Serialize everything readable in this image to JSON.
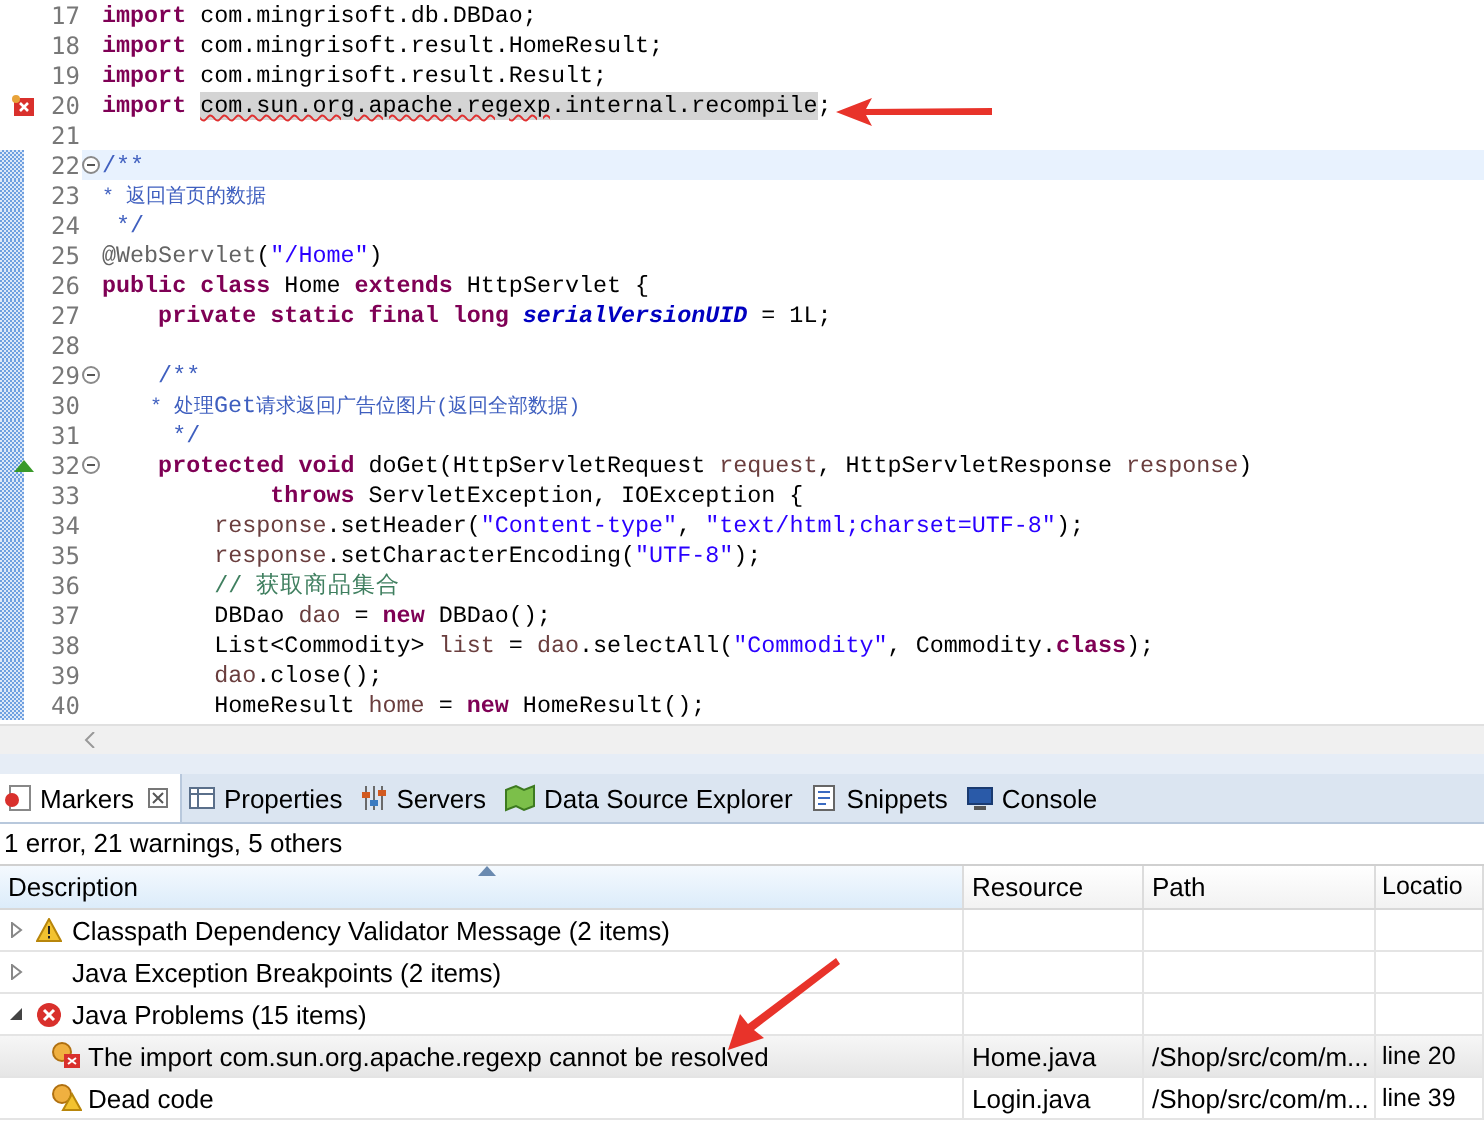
{
  "editor": {
    "lines": [
      {
        "number": "17",
        "kind": "plain",
        "fold": false,
        "range": false,
        "current": false,
        "tokens": [
          {
            "kind": "kw",
            "text": "import "
          },
          {
            "kind": "plain",
            "text": "com.mingrisoft.db.DBDao;"
          }
        ]
      },
      {
        "number": "18",
        "kind": "plain",
        "fold": false,
        "range": false,
        "current": false,
        "tokens": [
          {
            "kind": "kw",
            "text": "import "
          },
          {
            "kind": "plain",
            "text": "com.mingrisoft.result.HomeResult;"
          }
        ]
      },
      {
        "number": "19",
        "kind": "plain",
        "fold": false,
        "range": false,
        "current": false,
        "tokens": [
          {
            "kind": "kw",
            "text": "import "
          },
          {
            "kind": "plain",
            "text": "com.mingrisoft.result.Result;"
          }
        ]
      },
      {
        "number": "20",
        "kind": "error",
        "fold": false,
        "range": false,
        "current": false,
        "tokens": [
          {
            "kind": "kw",
            "text": "import "
          },
          {
            "kind": "error",
            "text": "com.sun.org.apache.regexp"
          },
          {
            "kind": "selected",
            "text": ".internal.recompile"
          },
          {
            "kind": "plain",
            "text": ";"
          }
        ]
      },
      {
        "number": "21",
        "kind": "plain",
        "fold": false,
        "range": false,
        "current": false
      },
      {
        "number": "22",
        "kind": "plain",
        "fold": true,
        "range": true,
        "current": true,
        "tokens": [
          {
            "kind": "javadoc",
            "text": "/**"
          }
        ]
      },
      {
        "number": "23",
        "kind": "plain",
        "fold": false,
        "range": true,
        "current": false,
        "tokens": [
          {
            "kind": "javadoc-cjk",
            "text": "* 返回首页的数据"
          }
        ]
      },
      {
        "number": "24",
        "kind": "plain",
        "fold": false,
        "range": true,
        "current": false,
        "tokens": [
          {
            "kind": "javadoc",
            "text": " */"
          }
        ]
      },
      {
        "number": "25",
        "kind": "plain",
        "fold": false,
        "range": true,
        "current": false,
        "tokens": [
          {
            "kind": "annot",
            "text": "@WebServlet"
          },
          {
            "kind": "plain",
            "text": "("
          },
          {
            "kind": "str",
            "text": "\"/Home\""
          },
          {
            "kind": "plain",
            "text": ")"
          }
        ]
      },
      {
        "number": "26",
        "kind": "plain",
        "fold": false,
        "range": true,
        "current": false,
        "tokens": [
          {
            "kind": "kw",
            "text": "public class"
          },
          {
            "kind": "plain",
            "text": " Home "
          },
          {
            "kind": "kw",
            "text": "extends"
          },
          {
            "kind": "plain",
            "text": " HttpServlet {"
          }
        ]
      },
      {
        "number": "27",
        "kind": "plain",
        "fold": false,
        "range": true,
        "current": false,
        "tokens": [
          {
            "kind": "kw",
            "text": "    private static final long "
          },
          {
            "kind": "field",
            "text": "serialVersionUID"
          },
          {
            "kind": "plain",
            "text": " = 1L;"
          }
        ]
      },
      {
        "number": "28",
        "kind": "plain",
        "fold": false,
        "range": true,
        "current": false
      },
      {
        "number": "29",
        "kind": "plain",
        "fold": true,
        "range": true,
        "current": false,
        "tokens": [
          {
            "kind": "javadoc",
            "text": "    /**"
          }
        ]
      },
      {
        "number": "30",
        "kind": "plain",
        "fold": false,
        "range": true,
        "current": false,
        "tokens": [
          {
            "kind": "javadoc-cjk",
            "text": "    * 处理"
          },
          {
            "kind": "javadoc",
            "text": "Get"
          },
          {
            "kind": "javadoc-cjk",
            "text": "请求返回广告位图片(返回全部数据)"
          }
        ]
      },
      {
        "number": "31",
        "kind": "plain",
        "fold": false,
        "range": true,
        "current": false,
        "tokens": [
          {
            "kind": "javadoc",
            "text": "     */"
          }
        ]
      },
      {
        "number": "32",
        "kind": "override",
        "fold": true,
        "range": true,
        "current": false,
        "tokens": [
          {
            "kind": "kw",
            "text": "    protected void"
          },
          {
            "kind": "plain",
            "text": " doGet(HttpServletRequest "
          },
          {
            "kind": "var",
            "text": "request"
          },
          {
            "kind": "plain",
            "text": ", HttpServletResponse "
          },
          {
            "kind": "var",
            "text": "response"
          },
          {
            "kind": "plain",
            "text": ")"
          }
        ]
      },
      {
        "number": "33",
        "kind": "plain",
        "fold": false,
        "range": true,
        "current": false,
        "tokens": [
          {
            "kind": "kw",
            "text": "            throws"
          },
          {
            "kind": "plain",
            "text": " ServletException, IOException {"
          }
        ]
      },
      {
        "number": "34",
        "kind": "plain",
        "fold": false,
        "range": true,
        "current": false,
        "tokens": [
          {
            "kind": "var",
            "text": "        response"
          },
          {
            "kind": "plain",
            "text": ".setHeader("
          },
          {
            "kind": "str",
            "text": "\"Content-type\""
          },
          {
            "kind": "plain",
            "text": ", "
          },
          {
            "kind": "str",
            "text": "\"text/html;charset=UTF-8\""
          },
          {
            "kind": "plain",
            "text": ");"
          }
        ]
      },
      {
        "number": "35",
        "kind": "plain",
        "fold": false,
        "range": true,
        "current": false,
        "tokens": [
          {
            "kind": "var",
            "text": "        response"
          },
          {
            "kind": "plain",
            "text": ".setCharacterEncoding("
          },
          {
            "kind": "str",
            "text": "\"UTF-8\""
          },
          {
            "kind": "plain",
            "text": ");"
          }
        ]
      },
      {
        "number": "36",
        "kind": "plain",
        "fold": false,
        "range": true,
        "current": false,
        "tokens": [
          {
            "kind": "comment",
            "text": "        // 获取商品集合"
          }
        ]
      },
      {
        "number": "37",
        "kind": "plain",
        "fold": false,
        "range": true,
        "current": false,
        "tokens": [
          {
            "kind": "plain",
            "text": "        DBDao "
          },
          {
            "kind": "var",
            "text": "dao"
          },
          {
            "kind": "plain",
            "text": " = "
          },
          {
            "kind": "kw",
            "text": "new"
          },
          {
            "kind": "plain",
            "text": " DBDao();"
          }
        ]
      },
      {
        "number": "38",
        "kind": "plain",
        "fold": false,
        "range": true,
        "current": false,
        "tokens": [
          {
            "kind": "plain",
            "text": "        List<Commodity> "
          },
          {
            "kind": "var",
            "text": "list"
          },
          {
            "kind": "plain",
            "text": " = "
          },
          {
            "kind": "var",
            "text": "dao"
          },
          {
            "kind": "plain",
            "text": ".selectAll("
          },
          {
            "kind": "str",
            "text": "\"Commodity\""
          },
          {
            "kind": "plain",
            "text": ", Commodity."
          },
          {
            "kind": "kw",
            "text": "class"
          },
          {
            "kind": "plain",
            "text": ");"
          }
        ]
      },
      {
        "number": "39",
        "kind": "plain",
        "fold": false,
        "range": true,
        "current": false,
        "tokens": [
          {
            "kind": "var",
            "text": "        dao"
          },
          {
            "kind": "plain",
            "text": ".close();"
          }
        ]
      },
      {
        "number": "40",
        "kind": "plain",
        "fold": false,
        "range": true,
        "current": false,
        "tokens": [
          {
            "kind": "plain",
            "text": "        HomeResult "
          },
          {
            "kind": "var",
            "text": "home"
          },
          {
            "kind": "plain",
            "text": " = "
          },
          {
            "kind": "kw",
            "text": "new"
          },
          {
            "kind": "plain",
            "text": " HomeResult();"
          }
        ]
      }
    ]
  },
  "tabs": [
    {
      "label": "Markers",
      "selected": true,
      "closable": true
    },
    {
      "label": "Properties",
      "selected": false,
      "closable": false
    },
    {
      "label": "Servers",
      "selected": false,
      "closable": false
    },
    {
      "label": "Data Source Explorer",
      "selected": false,
      "closable": false
    },
    {
      "label": "Snippets",
      "selected": false,
      "closable": false
    },
    {
      "label": "Console",
      "selected": false,
      "closable": false
    }
  ],
  "summary": "1 error, 21 warnings, 5 others",
  "table": {
    "columns": [
      "Description",
      "Resource",
      "Path",
      "Locatio"
    ],
    "rows": [
      {
        "description": "Classpath Dependency Validator Message (2 items)",
        "kind": "warning",
        "expanded": false,
        "selected": false
      },
      {
        "description": "Java Exception Breakpoints (2 items)",
        "kind": "none",
        "expanded": false,
        "selected": false
      },
      {
        "description": "Java Problems (15 items)",
        "kind": "error",
        "expanded": true,
        "selected": false,
        "children": [
          {
            "description": "The import com.sun.org.apache.regexp cannot be resolved",
            "kind": "error",
            "selected": true,
            "resource": "Home.java",
            "path": "/Shop/src/com/m...",
            "location": "line 20"
          },
          {
            "description": "Dead code",
            "kind": "warning",
            "selected": false,
            "resource": "Login.java",
            "path": "/Shop/src/com/m...",
            "location": "line 39"
          }
        ]
      }
    ]
  }
}
